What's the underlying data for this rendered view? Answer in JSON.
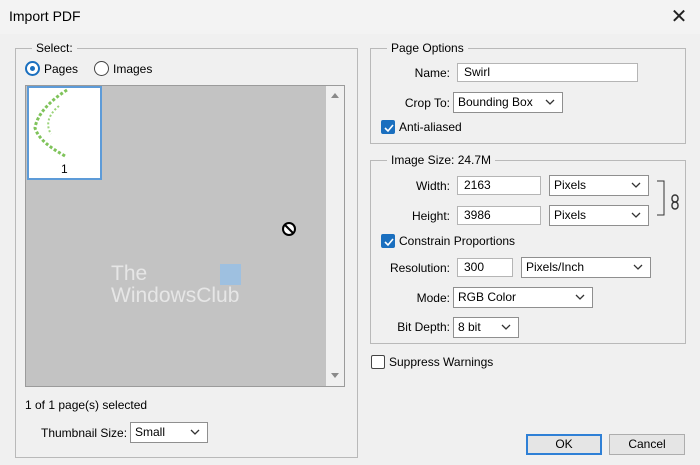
{
  "window": {
    "title": "Import PDF",
    "close_glyph": "✕"
  },
  "select_panel": {
    "legend": "Select:",
    "radio_pages": "Pages",
    "radio_images": "Images",
    "thumbnail_page_number": "1",
    "selection_status": "1 of 1 page(s) selected",
    "thumbnail_size_label": "Thumbnail Size:",
    "thumbnail_size_value": "Small"
  },
  "watermark": {
    "line1": "The",
    "line2": "WindowsClub"
  },
  "page_options": {
    "legend": "Page Options",
    "name_label": "Name:",
    "name_value": "Swirl",
    "crop_label": "Crop To:",
    "crop_value": "Bounding Box",
    "anti_aliased_label": "Anti-aliased"
  },
  "image_size": {
    "legend": "Image Size: 24.7M",
    "width_label": "Width:",
    "width_value": "2163",
    "width_unit": "Pixels",
    "height_label": "Height:",
    "height_value": "3986",
    "height_unit": "Pixels",
    "constrain_label": "Constrain Proportions",
    "resolution_label": "Resolution:",
    "resolution_value": "300",
    "resolution_unit": "Pixels/Inch",
    "mode_label": "Mode:",
    "mode_value": "RGB Color",
    "bit_depth_label": "Bit Depth:",
    "bit_depth_value": "8 bit"
  },
  "suppress_warnings_label": "Suppress Warnings",
  "buttons": {
    "ok": "OK",
    "cancel": "Cancel"
  },
  "colors": {
    "accent": "#1a6fbf",
    "preview_bg": "#c3c3c3",
    "thumb_border": "#5d9bd8"
  },
  "icons": [
    "close-icon",
    "chevron-down-icon",
    "check-icon",
    "chain-link-icon",
    "not-allowed-cursor-icon",
    "scroll-up-icon",
    "scroll-down-icon"
  ]
}
